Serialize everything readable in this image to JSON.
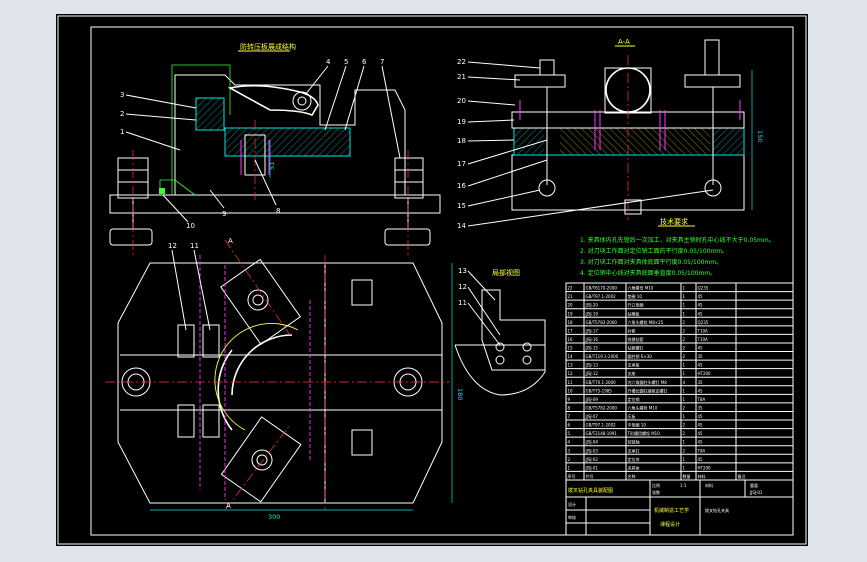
{
  "drawing": {
    "section_top_left_title": "防转压板展成结构",
    "section_top_right_title": "A-A",
    "section_mid_title": "局部视图",
    "tech_req_title": "技术要求",
    "tech_req_items": [
      "1. 夹具体内孔先镗后一次加工，对夹具主销时孔中心线不大于0.05mm。",
      "2. 对刀块工作面对定位销工面的平行度0.05/100mm。",
      "3. 对刀块工作面对夹具体底面平行度0.05/100mm。",
      "4. 定位销中心线对夹具底面垂直度0.05/100mm。"
    ],
    "callouts_left": [
      "3",
      "2",
      "1",
      "4",
      "5",
      "6",
      "7",
      "8",
      "9",
      "10",
      "11",
      "12"
    ],
    "callouts_right": [
      "22",
      "21",
      "20",
      "19",
      "18",
      "17",
      "16",
      "15",
      "14"
    ],
    "callouts_mid": [
      "13",
      "12",
      "11"
    ],
    "dimensions": {
      "overall_width": "300",
      "height_right": "180",
      "height_left": "160",
      "aa_height": "150",
      "side_small": "51",
      "section_a": "A"
    },
    "title_block": {
      "part_name": "拨叉钻孔夹具",
      "company": "机械制造工艺学",
      "subtitle": "课程设计",
      "scale_label": "比例",
      "scale_value": "1:1",
      "sheet_label": "张数",
      "drawn_label": "设计",
      "checked_label": "审核",
      "material_label": "材料",
      "weight_label": "重量",
      "drawing_no": "JJSJ-01",
      "bottom_left_title": "拨叉钻孔夹具装配图"
    },
    "bom_headers": [
      "序号",
      "代号",
      "名称",
      "数量",
      "材料",
      "备注"
    ],
    "bom_rows": [
      [
        "22",
        "GB/T6170-2000",
        "六角螺母 M10",
        "1",
        "Q235",
        ""
      ],
      [
        "21",
        "GB/T97.1-2002",
        "垫圈 10",
        "1",
        "45",
        ""
      ],
      [
        "20",
        "JJSJ-20",
        "开口垫圈",
        "1",
        "45",
        ""
      ],
      [
        "19",
        "JJSJ-19",
        "钻模板",
        "1",
        "45",
        ""
      ],
      [
        "18",
        "GB/T5783-2000",
        "六角头螺栓 M8×25",
        "2",
        "Q235",
        ""
      ],
      [
        "17",
        "JJSJ-17",
        "衬套",
        "2",
        "T10A",
        ""
      ],
      [
        "16",
        "JJSJ-16",
        "快换钻套",
        "2",
        "T10A",
        ""
      ],
      [
        "15",
        "JJSJ-15",
        "钻套螺钉",
        "2",
        "45",
        ""
      ],
      [
        "14",
        "GB/T119.1-2000",
        "圆柱销 6×30",
        "2",
        "35",
        ""
      ],
      [
        "13",
        "JJSJ-13",
        "支承板",
        "1",
        "45",
        ""
      ],
      [
        "12",
        "JJSJ-12",
        "支座",
        "1",
        "HT200",
        ""
      ],
      [
        "11",
        "GB/T70.1-2000",
        "内六角圆柱头螺钉 M8",
        "4",
        "35",
        ""
      ],
      [
        "10",
        "GB/T75-1985",
        "开槽长圆柱端紧定螺钉",
        "1",
        "45",
        ""
      ],
      [
        "9",
        "JJSJ-09",
        "定位销",
        "1",
        "T8A",
        ""
      ],
      [
        "8",
        "GB/T5782-2000",
        "六角头螺栓 M10",
        "2",
        "35",
        ""
      ],
      [
        "7",
        "JJSJ-07",
        "压板",
        "1",
        "45",
        ""
      ],
      [
        "6",
        "GB/T97.1-2002",
        "平垫圈 10",
        "2",
        "45",
        ""
      ],
      [
        "5",
        "GB/T2148-1991",
        "T形槽用螺栓 M10",
        "2",
        "45",
        ""
      ],
      [
        "4",
        "JJSJ-04",
        "铰链轴",
        "1",
        "45",
        ""
      ],
      [
        "3",
        "JJSJ-03",
        "支承钉",
        "2",
        "T8A",
        ""
      ],
      [
        "2",
        "JJSJ-02",
        "定位块",
        "1",
        "45",
        ""
      ],
      [
        "1",
        "JJSJ-01",
        "夹具体",
        "1",
        "HT200",
        ""
      ]
    ]
  },
  "colors": {
    "sheet": "#000000",
    "outline": "#ffffff",
    "callout": "#ffff33",
    "section": "#00e5e5",
    "hidden": "#ff33ff",
    "center": "#ff3333",
    "note": "#33ff33",
    "backdrop": "#dfe3ea"
  }
}
